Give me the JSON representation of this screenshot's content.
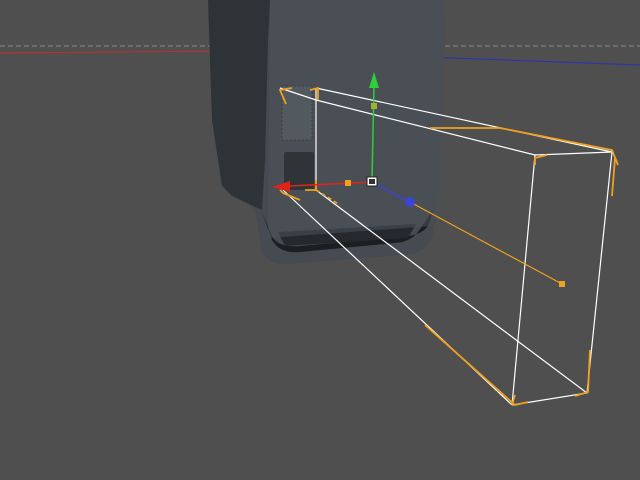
{
  "viewport": {
    "background": "#4f4f4f",
    "objects": [
      {
        "name": "device-body",
        "color": "#454b51"
      },
      {
        "name": "light-frustum",
        "color": "#ffffff"
      }
    ],
    "gizmo": {
      "x_axis_color": "#e0241b",
      "y_axis_color": "#2fcf3a",
      "z_axis_color": "#3a45d8",
      "handle_color": "#f0a020",
      "center_icon": "move-gizmo-center-icon"
    },
    "selection_color": "#f0a020",
    "horizon_color": "#8a8a8a"
  }
}
